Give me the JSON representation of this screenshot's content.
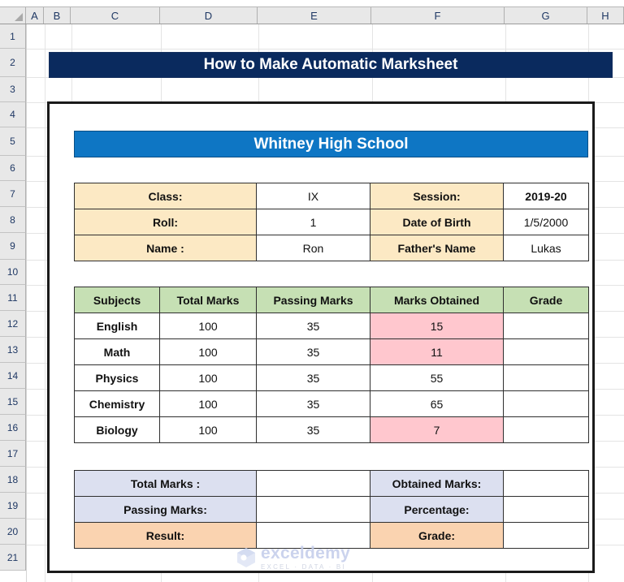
{
  "spreadsheet": {
    "column_headers": [
      "A",
      "B",
      "C",
      "D",
      "E",
      "F",
      "G",
      "H"
    ],
    "row_headers": [
      "1",
      "2",
      "3",
      "4",
      "5",
      "6",
      "7",
      "8",
      "9",
      "10",
      "11",
      "12",
      "13",
      "14",
      "15",
      "16",
      "17",
      "18",
      "19",
      "20",
      "21"
    ],
    "select_all_icon": "select-all-triangle-icon"
  },
  "colors": {
    "title_banner": "#0A2A5E",
    "school_banner": "#0E76C4",
    "info_label": "#FCE9C4",
    "table_header": "#C6E0B4",
    "fail_highlight": "#FFC7CE",
    "fail_text": "#9C0006",
    "summary_label": "#DCE0F0",
    "result_label": "#FAD3B0"
  },
  "title_banner": {
    "text": "How to Make Automatic Marksheet"
  },
  "school_banner": {
    "text": "Whitney High School"
  },
  "student_info": {
    "rows": [
      {
        "label_left": "Class:",
        "value_left": "IX",
        "label_right": "Session:",
        "value_right": "2019-20"
      },
      {
        "label_left": "Roll:",
        "value_left": "1",
        "label_right": "Date of Birth",
        "value_right": "1/5/2000"
      },
      {
        "label_left": "Name :",
        "value_left": "Ron",
        "label_right": "Father's Name",
        "value_right": "Lukas"
      }
    ]
  },
  "marks_table": {
    "headers": [
      "Subjects",
      "Total Marks",
      "Passing Marks",
      "Marks Obtained",
      "Grade"
    ],
    "rows": [
      {
        "subject": "English",
        "total": "100",
        "passing": "35",
        "obtained": "15",
        "grade": "",
        "failed": true
      },
      {
        "subject": "Math",
        "total": "100",
        "passing": "35",
        "obtained": "11",
        "grade": "",
        "failed": true
      },
      {
        "subject": "Physics",
        "total": "100",
        "passing": "35",
        "obtained": "55",
        "grade": "",
        "failed": false
      },
      {
        "subject": "Chemistry",
        "total": "100",
        "passing": "35",
        "obtained": "65",
        "grade": "",
        "failed": false
      },
      {
        "subject": "Biology",
        "total": "100",
        "passing": "35",
        "obtained": "7",
        "grade": "",
        "failed": true
      }
    ]
  },
  "summary": {
    "rows": [
      {
        "label_left": "Total Marks :",
        "value_left": "",
        "label_right": "Obtained Marks:",
        "value_right": "",
        "style": "lavender"
      },
      {
        "label_left": "Passing Marks:",
        "value_left": "",
        "label_right": "Percentage:",
        "value_right": "",
        "style": "lavender"
      },
      {
        "label_left": "Result:",
        "value_left": "",
        "label_right": "Grade:",
        "value_right": "",
        "style": "peach"
      }
    ]
  },
  "watermark": {
    "main": "exceldemy",
    "sub": "EXCEL · DATA · BI",
    "logo_icon": "exceldemy-cube-logo-icon"
  }
}
